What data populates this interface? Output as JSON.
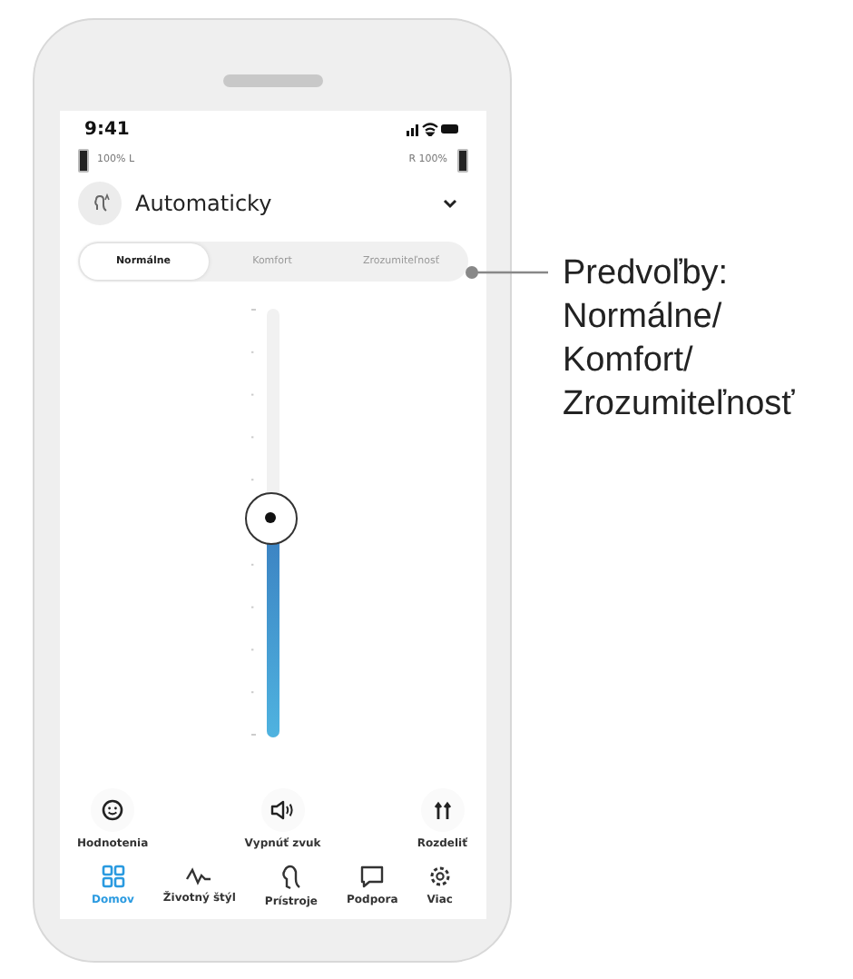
{
  "status_bar": {
    "time": "9:41"
  },
  "batteries": {
    "left": "100% L",
    "right": "R 100%"
  },
  "program": {
    "name": "Automaticky"
  },
  "tabs": [
    {
      "label": "Normálne",
      "selected": true
    },
    {
      "label": "Komfort",
      "selected": false
    },
    {
      "label": "Zrozumiteľnosť",
      "selected": false
    }
  ],
  "volume": {
    "level": 0.51
  },
  "actions": [
    {
      "kind": "rating",
      "label": "Hodnotenia"
    },
    {
      "kind": "mute",
      "label": "Vypnúť zvuk"
    },
    {
      "kind": "split",
      "label": "Rozdeliť"
    }
  ],
  "nav": [
    {
      "kind": "home",
      "label": "Domov",
      "selected": true
    },
    {
      "kind": "lifestyle",
      "label": "Životný štýl",
      "selected": false
    },
    {
      "kind": "devices",
      "label": "Prístroje",
      "selected": false
    },
    {
      "kind": "support",
      "label": "Podpora",
      "selected": false
    },
    {
      "kind": "more",
      "label": "Viac",
      "selected": false
    }
  ],
  "callout": {
    "lines": [
      "Predvoľby:",
      "Normálne/",
      "Komfort/",
      "Zrozumiteľnosť"
    ]
  }
}
